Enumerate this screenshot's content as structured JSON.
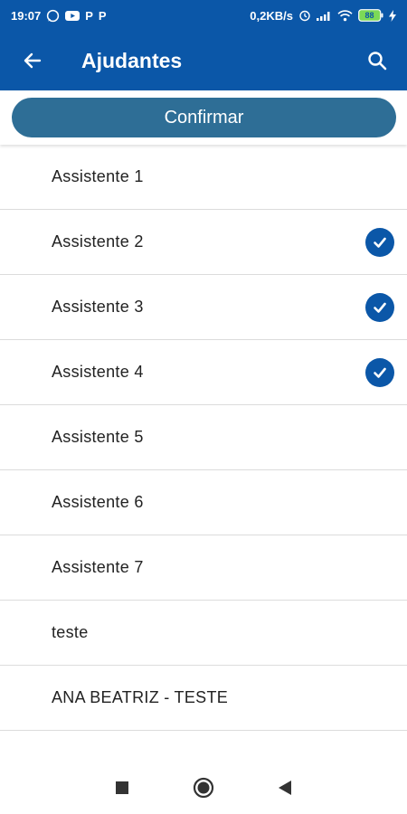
{
  "statusbar": {
    "time": "19:07",
    "p1": "P",
    "p2": "P",
    "speed": "0,2KB/s",
    "battery": "88",
    "icons": [
      "whatsapp-icon",
      "youtube-icon",
      "alarm-icon",
      "signal-icon",
      "wifi-icon",
      "battery-icon",
      "charging-icon"
    ]
  },
  "appbar": {
    "title": "Ajudantes",
    "back_icon": "arrow-left-icon",
    "search_icon": "search-icon",
    "color": "#0b57a8"
  },
  "confirm": {
    "label": "Confirmar",
    "color": "#2e6e96"
  },
  "list": {
    "check_icon": "check-circle-icon",
    "items": [
      {
        "label": "Assistente 1",
        "checked": false
      },
      {
        "label": "Assistente 2",
        "checked": true
      },
      {
        "label": "Assistente 3",
        "checked": true
      },
      {
        "label": "Assistente 4",
        "checked": true
      },
      {
        "label": "Assistente 5",
        "checked": false
      },
      {
        "label": "Assistente 6",
        "checked": false
      },
      {
        "label": "Assistente 7",
        "checked": false
      },
      {
        "label": "teste",
        "checked": false
      },
      {
        "label": "ANA BEATRIZ - TESTE",
        "checked": false
      }
    ]
  },
  "navbar": {
    "icons": [
      "square-recents-icon",
      "circle-home-icon",
      "triangle-back-icon"
    ]
  }
}
